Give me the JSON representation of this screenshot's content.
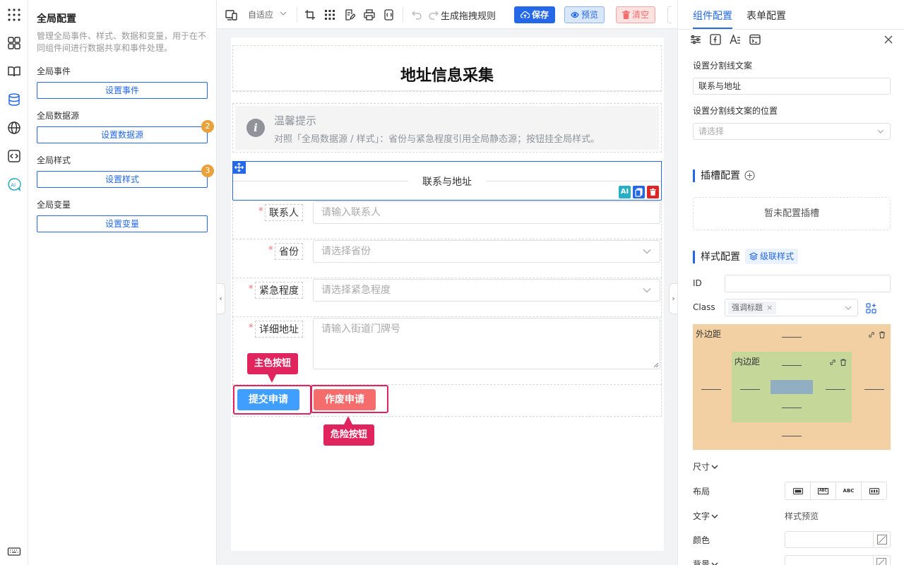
{
  "left_panel": {
    "title": "全局配置",
    "description": "管理全局事件、样式、数据和变量，用于在不同组件间进行数据共享和事件处理。",
    "sections": [
      {
        "label": "全局事件",
        "button": "设置事件",
        "badge": ""
      },
      {
        "label": "全局数据源",
        "button": "设置数据源",
        "badge": "2"
      },
      {
        "label": "全局样式",
        "button": "设置样式",
        "badge": "3"
      },
      {
        "label": "全局变量",
        "button": "设置变量",
        "badge": ""
      }
    ]
  },
  "toolbar": {
    "device_select": "自适应",
    "rules": "生成拖拽规则",
    "save": "保存",
    "preview": "预览",
    "clear": "清空"
  },
  "form": {
    "title": "地址信息采集",
    "tip_title": "温馨提示",
    "tip_text": "对照「全局数据源 / 样式」：省份与紧急程度引用全局静态源；按钮挂全局样式。",
    "divider": "联系与地址",
    "fields": [
      {
        "label": "联系人",
        "placeholder": "请输入联系人",
        "type": "input"
      },
      {
        "label": "省份",
        "placeholder": "请选择省份",
        "type": "select"
      },
      {
        "label": "紧急程度",
        "placeholder": "请选择紧急程度",
        "type": "select"
      },
      {
        "label": "详细地址",
        "placeholder": "请输入街道门牌号",
        "type": "textarea"
      }
    ],
    "submit": "提交申请",
    "void": "作废申请",
    "callout_primary": "主色按钮",
    "callout_danger": "危险按钮"
  },
  "right_panel": {
    "tabs": [
      "组件配置",
      "表单配置"
    ],
    "divider_text_label": "设置分割线文案",
    "divider_text_value": "联系与地址",
    "divider_pos_label": "设置分割线文案的位置",
    "divider_pos_placeholder": "请选择",
    "slot_title": "插槽配置",
    "slot_empty": "暂未配置插槽",
    "style_title": "样式配置",
    "cascade": "级联样式",
    "id_label": "ID",
    "class_label": "Class",
    "class_tag": "强调标题",
    "margin_label": "外边距",
    "padding_label": "内边距",
    "size_label": "尺寸",
    "layout_label": "布局",
    "text_label": "文字",
    "style_preview": "样式预览",
    "color_label": "颜色",
    "bg_label": "背景",
    "layout_options": [
      "ABC",
      "ABC"
    ]
  },
  "colors": {
    "primary": "#2468e8",
    "danger": "#f56c6c",
    "callout": "#e0245e",
    "margin_box": "#f3d0a3",
    "padding_box": "#c6d79a",
    "content_box": "#91afc0"
  }
}
